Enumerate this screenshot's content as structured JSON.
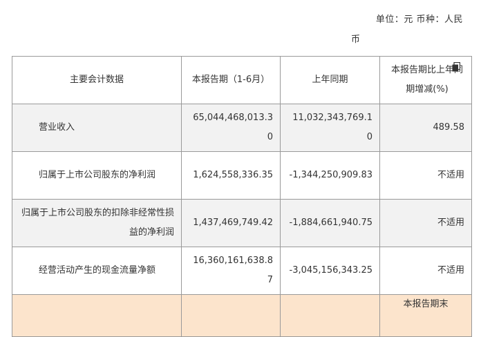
{
  "unit_note": {
    "line1": "单位：元  币种：人民",
    "line2": "币"
  },
  "table": {
    "headers": [
      "主要会计数据",
      "本报告期（1-6月）",
      "上年同期",
      "本报告期比上年同期增减(%)"
    ],
    "rows": [
      {
        "label": "营业收入",
        "current": "65,044,468,013.30",
        "prior": "11,032,343,769.10",
        "change": "489.58"
      },
      {
        "label": "归属于上市公司股东的净利润",
        "current": "1,624,558,336.35",
        "prior": "-1,344,250,909.83",
        "change": "不适用"
      },
      {
        "label": "归属于上市公司股东的扣除非经常性损益的净利润",
        "current": "1,437,469,749.42",
        "prior": "-1,884,661,940.75",
        "change": "不适用"
      },
      {
        "label": "经营活动产生的现金流量净额",
        "current": "16,360,161,638.87",
        "prior": "-3,045,156,343.25",
        "change": "不适用"
      }
    ],
    "tail_header": "本报告期末"
  }
}
